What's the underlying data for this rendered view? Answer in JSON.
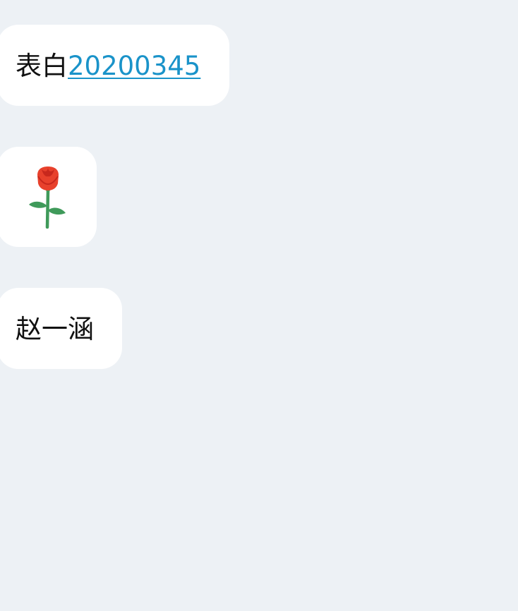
{
  "messages": [
    {
      "text_prefix": "表白",
      "link_text": "20200345"
    },
    {
      "sticker": "rose-icon",
      "sticker_colors": {
        "petal": "#e8412c",
        "petal_dark": "#c8281d",
        "stem": "#3f9a5a"
      }
    },
    {
      "text": "赵一涵"
    }
  ],
  "colors": {
    "background": "#edf1f5",
    "bubble": "#ffffff",
    "text": "#111111",
    "link": "#1a93c9"
  }
}
